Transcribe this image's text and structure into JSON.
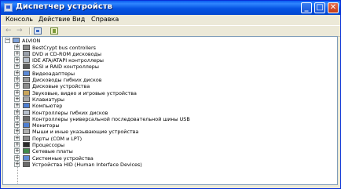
{
  "window": {
    "title": "Диспетчер устройств",
    "controls": [
      "_",
      "□",
      "✕"
    ]
  },
  "menu": [
    "Консоль",
    "Действие",
    "Вид",
    "Справка"
  ],
  "toolbar": {
    "back": "←",
    "forward": "→"
  },
  "tree": {
    "root": "ALVION",
    "root_expander": "−",
    "expander": "+",
    "items": [
      {
        "label": "BestCrypt bus controllers",
        "icon": "bus-controller-icon",
        "color": "#8a8a8a"
      },
      {
        "label": "DVD и CD-ROM дисководы",
        "icon": "cdrom-icon",
        "color": "#9aa0aa"
      },
      {
        "label": "IDE ATA/ATAPI контроллеры",
        "icon": "ide-controller-icon",
        "color": "#b8c0cc"
      },
      {
        "label": "SCSI и RAID контроллеры",
        "icon": "scsi-controller-icon",
        "color": "#5a5a5a"
      },
      {
        "label": "Видеоадаптеры",
        "icon": "display-adapter-icon",
        "color": "#5d8ad6"
      },
      {
        "label": "Дисководы гибких дисков",
        "icon": "floppy-drive-icon",
        "color": "#9a9a9a"
      },
      {
        "label": "Дисковые устройства",
        "icon": "hard-disk-icon",
        "color": "#8c8c8c"
      },
      {
        "label": "Звуковые, видео и игровые устройства",
        "icon": "sound-icon",
        "color": "#c9a45a"
      },
      {
        "label": "Клавиатуры",
        "icon": "keyboard-icon",
        "color": "#a8a8a8"
      },
      {
        "label": "Компьютер",
        "icon": "computer-icon",
        "color": "#4f7fd0"
      },
      {
        "label": "Контроллеры гибких дисков",
        "icon": "floppy-controller-icon",
        "color": "#b8c0cc"
      },
      {
        "label": "Контроллеры универсальной последовательной шины USB",
        "icon": "usb-icon",
        "color": "#6a6a6a"
      },
      {
        "label": "Мониторы",
        "icon": "monitor-icon",
        "color": "#4f7fd0"
      },
      {
        "label": "Мыши и иные указывающие устройства",
        "icon": "mouse-icon",
        "color": "#b0b0b0"
      },
      {
        "label": "Порты (COM и LPT)",
        "icon": "port-icon",
        "color": "#8a8a8a"
      },
      {
        "label": "Процессоры",
        "icon": "processor-icon",
        "color": "#2a2a2a"
      },
      {
        "label": "Сетевые платы",
        "icon": "network-adapter-icon",
        "color": "#3f8a4a"
      },
      {
        "label": "Системные устройства",
        "icon": "system-device-icon",
        "color": "#5d8ad6"
      },
      {
        "label": "Устройства HID (Human Interface Devices)",
        "icon": "hid-icon",
        "color": "#6a6a6a"
      }
    ]
  }
}
